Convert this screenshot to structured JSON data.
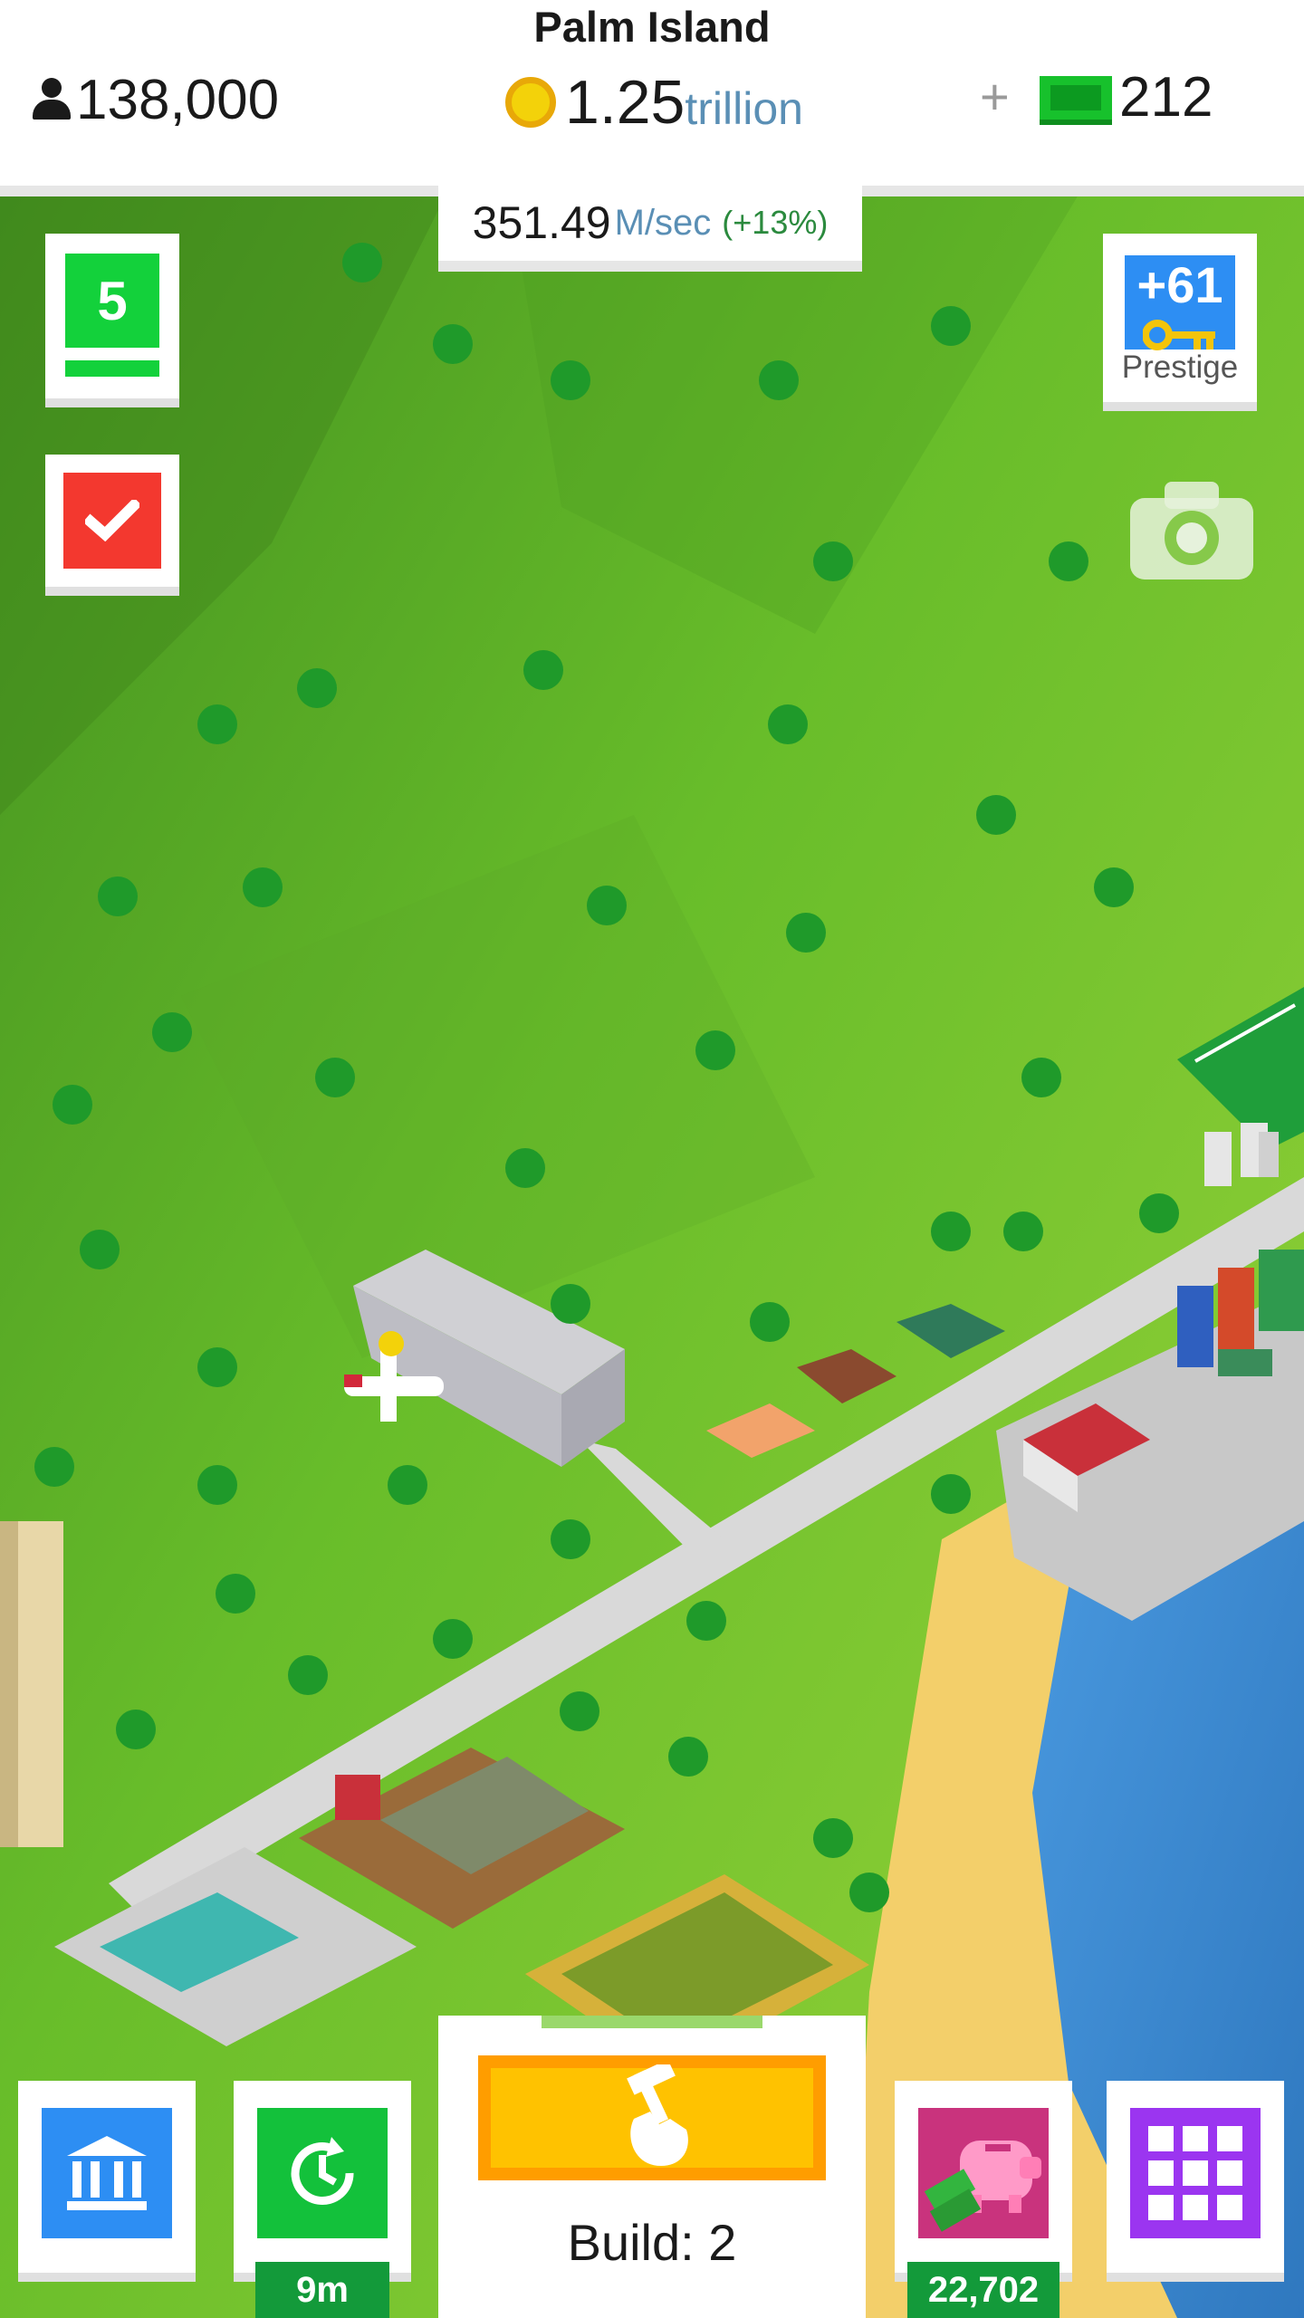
{
  "header": {
    "island_name": "Palm Island",
    "population": "138,000",
    "coins_value": "1.25",
    "coins_unit": "trillion",
    "plus": "+",
    "cash": "212"
  },
  "income": {
    "value": "351.49",
    "unit": "M/sec",
    "bonus": "(+13%)"
  },
  "level": {
    "value": "5"
  },
  "prestige": {
    "value": "+61",
    "label": "Prestige"
  },
  "bottom": {
    "boost_timer": "9m",
    "build_label": "Build: 2",
    "piggy_bank": "22,702"
  },
  "colors": {
    "grass": "#6cc42c",
    "ocean": "#3f8fd1",
    "sand": "#f3cf6a",
    "road": "#d9d9d9",
    "accent_green": "#13d13b",
    "accent_blue": "#2d8ef3",
    "accent_red": "#f3382f",
    "accent_purple": "#9b35f0",
    "accent_yellow": "#ffc200"
  },
  "icons": [
    "person-icon",
    "coin-icon",
    "cash-icon",
    "check-icon",
    "key-icon",
    "camera-icon",
    "bank-icon",
    "clock-refresh-icon",
    "hammer-hand-icon",
    "piggy-bank-icon",
    "grid-menu-icon"
  ]
}
